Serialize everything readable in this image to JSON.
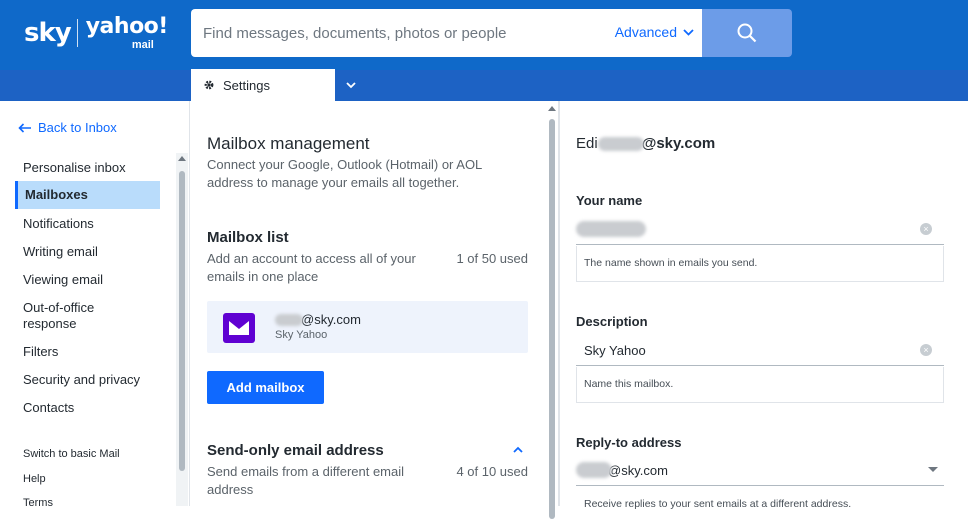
{
  "brand": {
    "sky": "sky",
    "yahoo": "yahoo!",
    "mail": "mail"
  },
  "search": {
    "placeholder": "Find messages, documents, photos or people",
    "advanced_label": "Advanced"
  },
  "tabs": {
    "settings_label": "Settings"
  },
  "sidebar": {
    "back_label": "Back to Inbox",
    "items": [
      {
        "label": "Personalise inbox"
      },
      {
        "label": "Mailboxes"
      },
      {
        "label": "Notifications"
      },
      {
        "label": "Writing email"
      },
      {
        "label": "Viewing email"
      },
      {
        "label": "Out-of-office response"
      },
      {
        "label": "Filters"
      },
      {
        "label": "Security and privacy"
      },
      {
        "label": "Contacts"
      }
    ],
    "footer": [
      {
        "label": "Switch to basic Mail"
      },
      {
        "label": "Help"
      },
      {
        "label": "Terms"
      }
    ]
  },
  "mailbox_management": {
    "title": "Mailbox management",
    "description": "Connect your Google, Outlook (Hotmail) or AOL address to manage your emails all together.",
    "list_title": "Mailbox list",
    "list_desc": "Add an account to access all of your emails in one place",
    "list_count": "1 of 50 used",
    "mailbox": {
      "email_suffix": "@sky.com",
      "name": "Sky Yahoo"
    },
    "add_button": "Add mailbox",
    "send_only_title": "Send-only email address",
    "send_only_desc": "Send emails from a different email address",
    "send_only_count": "4 of 10 used"
  },
  "edit_panel": {
    "heading_prefix": "Edi",
    "heading_suffix": "@sky.com",
    "your_name_label": "Your name",
    "your_name_value": "",
    "your_name_help": "The name shown in emails you send.",
    "description_label": "Description",
    "description_value": "Sky Yahoo",
    "description_help": "Name this mailbox.",
    "reply_to_label": "Reply-to address",
    "reply_to_suffix": "@sky.com",
    "reply_to_help": "Receive replies to your sent emails at a different address."
  },
  "colors": {
    "header": "#0f69c9",
    "subbar": "#1d62c4",
    "accent": "#0f69ff",
    "active_nav": "#b9dcfb",
    "mailbox_icon": "#6001d2"
  }
}
